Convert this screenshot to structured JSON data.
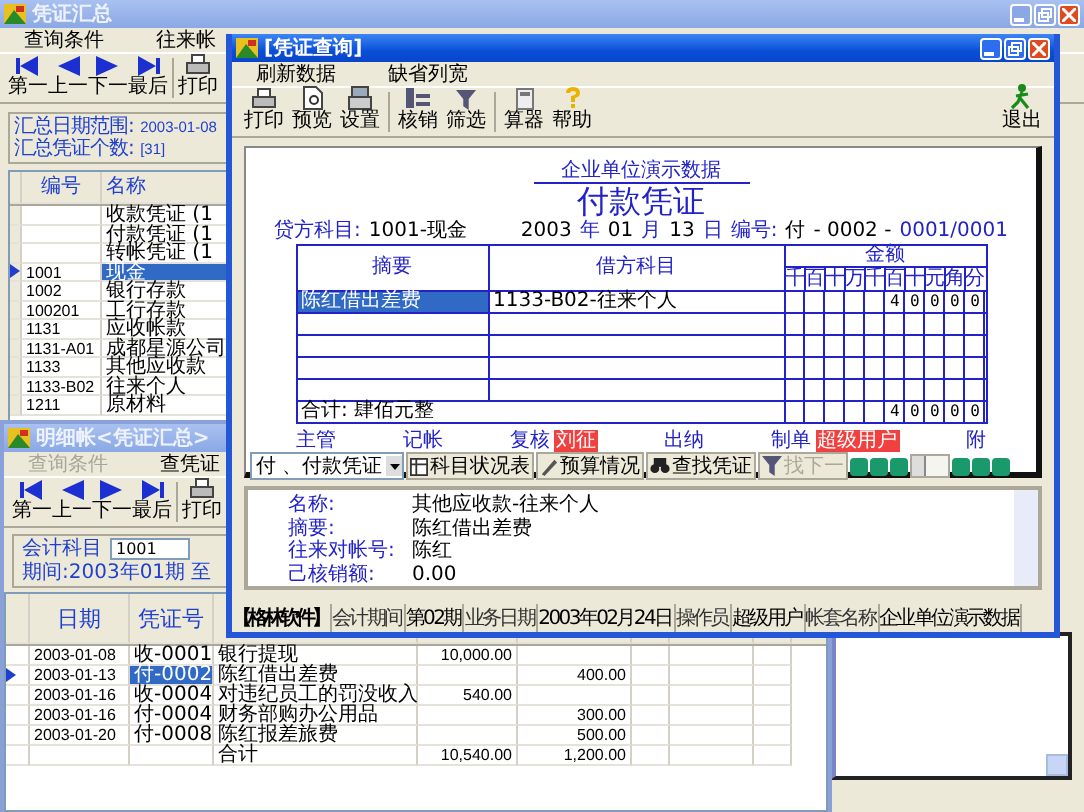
{
  "summary_window": {
    "title": "凭证汇总",
    "menu": [
      "查询条件",
      "往来帐"
    ],
    "toolbar": [
      {
        "kind": "first",
        "label": "第一"
      },
      {
        "kind": "prev",
        "label": "上一"
      },
      {
        "kind": "next",
        "label": "下一"
      },
      {
        "kind": "last",
        "label": "最后"
      },
      {
        "kind": "print",
        "label": "打印"
      }
    ],
    "info": [
      {
        "label": "汇总日期范围:",
        "value": "2003-01-08"
      },
      {
        "label": "汇总凭证个数:",
        "value": "[31]"
      }
    ],
    "table": {
      "columns": [
        "编号",
        "名称"
      ],
      "rows": [
        {
          "cells": [
            "",
            "收款凭证 (1"
          ],
          "selected": false
        },
        {
          "cells": [
            "",
            "付款凭证 (1"
          ],
          "selected": false
        },
        {
          "cells": [
            "",
            "转帐凭证 (1"
          ],
          "selected": false
        },
        {
          "cells": [
            "1001",
            "现金"
          ],
          "selected": true
        },
        {
          "cells": [
            "1002",
            "银行存款"
          ],
          "selected": false
        },
        {
          "cells": [
            "100201",
            "工行存款"
          ],
          "selected": false
        },
        {
          "cells": [
            "1131",
            "应收帐款"
          ],
          "selected": false
        },
        {
          "cells": [
            "1131-A01",
            "成都星源公司"
          ],
          "selected": false
        },
        {
          "cells": [
            "1133",
            "其他应收款"
          ],
          "selected": false
        },
        {
          "cells": [
            "1133-B02",
            "往来个人"
          ],
          "selected": false
        },
        {
          "cells": [
            "1211",
            "原材料"
          ],
          "selected": false
        }
      ]
    }
  },
  "detail_window": {
    "title": "明细帐<凭证汇总>",
    "menu": [
      {
        "label": "查询条件",
        "disabled": true
      },
      {
        "label": "查凭证",
        "disabled": false
      }
    ],
    "toolbar": [
      {
        "kind": "first",
        "label": "第一"
      },
      {
        "kind": "prev",
        "label": "上一"
      },
      {
        "kind": "next",
        "label": "下一"
      },
      {
        "kind": "last",
        "label": "最后"
      },
      {
        "kind": "print",
        "label": "打印"
      }
    ],
    "account_label": "会计科目",
    "account_value": "1001",
    "period": "期间:2003年01期 至",
    "table": {
      "columns": [
        "日期",
        "凭证号"
      ],
      "rows": [
        {
          "cells": [
            "2003-01-08",
            "收-0001",
            "银行提现",
            "10,000.00",
            ""
          ],
          "selected": false
        },
        {
          "cells": [
            "2003-01-13",
            "付-0002",
            "陈红借出差费",
            "",
            "400.00"
          ],
          "selected": true
        },
        {
          "cells": [
            "2003-01-16",
            "收-0004",
            "对违纪员工的罚没收入",
            "540.00",
            ""
          ],
          "selected": false
        },
        {
          "cells": [
            "2003-01-16",
            "付-0004",
            "财务部购办公用品",
            "",
            "300.00"
          ],
          "selected": false
        },
        {
          "cells": [
            "2003-01-20",
            "付-0008",
            "陈红报差旅费",
            "",
            "500.00"
          ],
          "selected": false
        },
        {
          "cells": [
            "",
            "",
            "合计",
            "10,540.00",
            "1,200.00"
          ],
          "selected": false
        }
      ]
    }
  },
  "query_window": {
    "title": "[凭证查询]",
    "menu": [
      "刷新数据",
      "缺省列宽"
    ],
    "toolbar": [
      {
        "kind": "print",
        "label": "打印"
      },
      {
        "kind": "preview",
        "label": "预览"
      },
      {
        "kind": "setup",
        "label": "设置"
      },
      {
        "kind": "verify",
        "label": "核销"
      },
      {
        "kind": "filter",
        "label": "筛选"
      },
      {
        "kind": "calc",
        "label": "算器"
      },
      {
        "kind": "help",
        "label": "帮助"
      }
    ],
    "exit_label": "退出",
    "voucher": {
      "company": "企业单位演示数据",
      "title": "付款凭证",
      "credit_label": "贷方科目:",
      "credit_value": "1001-现金",
      "date_parts": [
        {
          "text": "2003",
          "kind": "value"
        },
        {
          "text": "年",
          "kind": "label"
        },
        {
          "text": "01",
          "kind": "value"
        },
        {
          "text": "月",
          "kind": "label"
        },
        {
          "text": "13",
          "kind": "value"
        },
        {
          "text": "日",
          "kind": "label"
        },
        {
          "text": "编号:",
          "kind": "label"
        },
        {
          "text": "付",
          "kind": "value"
        },
        {
          "text": "- 0002 -",
          "kind": "value"
        },
        {
          "text": "0001/0001",
          "kind": "label"
        }
      ],
      "columns": [
        "摘要",
        "借方科目",
        "金额"
      ],
      "digit_units": [
        "千",
        "百",
        "十",
        "万",
        "千",
        "百",
        "十",
        "元",
        "角",
        "分"
      ],
      "rows": [
        {
          "summary": "陈红借出差费",
          "account": "1133-B02-往来个人",
          "amount": "40000",
          "selected": true
        },
        {
          "summary": "",
          "account": "",
          "amount": "",
          "selected": false
        },
        {
          "summary": "",
          "account": "",
          "amount": "",
          "selected": false
        },
        {
          "summary": "",
          "account": "",
          "amount": "",
          "selected": false
        },
        {
          "summary": "",
          "account": "",
          "amount": "",
          "selected": false
        }
      ],
      "total_label": "合计: 肆佰元整",
      "total_amount": "40000",
      "signatures": [
        {
          "label": "主管"
        },
        {
          "label": "记帐"
        },
        {
          "label": "复核",
          "stamp": "刘征"
        },
        {
          "label": "出纳"
        },
        {
          "label": "制单",
          "stamp": "超级用户"
        },
        {
          "label": "附"
        }
      ]
    },
    "voucher_type": "付  、付款凭证",
    "bar_buttons": [
      {
        "kind": "table",
        "label": "科目状况表",
        "disabled": false
      },
      {
        "kind": "budget",
        "label": "预算情况",
        "disabled": false
      },
      {
        "kind": "find",
        "label": "查找凭证",
        "disabled": false
      },
      {
        "kind": "filter",
        "label": "找下一",
        "disabled": true
      }
    ],
    "entry_details": [
      {
        "label": "名称:",
        "value": "其他应收款-往来个人"
      },
      {
        "label": "摘要:",
        "value": "陈红借出差费"
      },
      {
        "label": "往来对帐号:",
        "value": "陈红"
      },
      {
        "label": "己核销额:",
        "value": "0.00"
      }
    ],
    "status_bar": [
      {
        "text": "【格林软件】",
        "kind": "brand"
      },
      {
        "text": "会计期间",
        "kind": "label"
      },
      {
        "text": "第02期",
        "kind": "value"
      },
      {
        "text": "业务日期",
        "kind": "label"
      },
      {
        "text": "2003年02月24日",
        "kind": "value"
      },
      {
        "text": "操作员",
        "kind": "label"
      },
      {
        "text": "超级用户",
        "kind": "value"
      },
      {
        "text": "帐套名称",
        "kind": "label"
      },
      {
        "text": "企业单位演示数据",
        "kind": "value"
      }
    ]
  }
}
